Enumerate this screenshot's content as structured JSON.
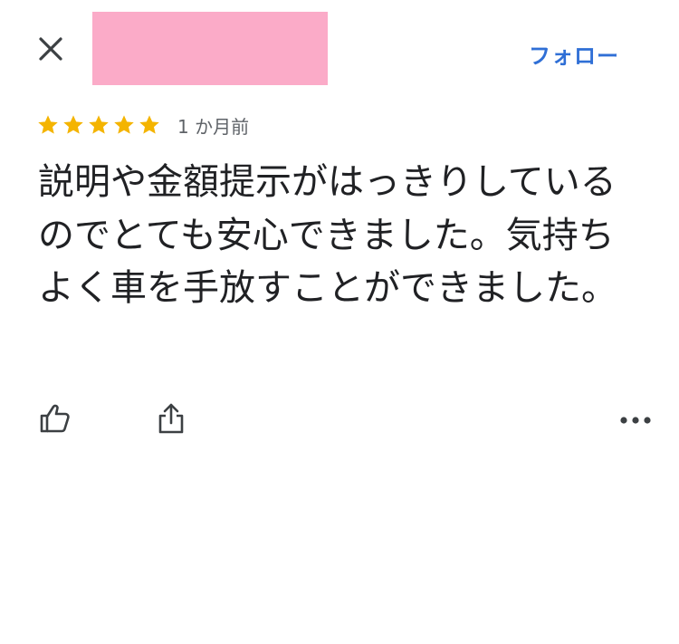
{
  "header": {
    "close_icon": "close-icon",
    "follow_label": "フォロー",
    "colors": {
      "accent": "#2f6fd6",
      "redaction": "#fbabc8"
    }
  },
  "review": {
    "rating": 5,
    "max_rating": 5,
    "star_color": "#f4b400",
    "date": "1 か月前",
    "text": "説明や金額提示がはっきりしているのでとても安心できました。気持ちよく車を手放すことができました。"
  },
  "actions": {
    "like_icon": "thumbs-up-icon",
    "share_icon": "share-icon",
    "more_icon": "more-horizontal-icon"
  }
}
